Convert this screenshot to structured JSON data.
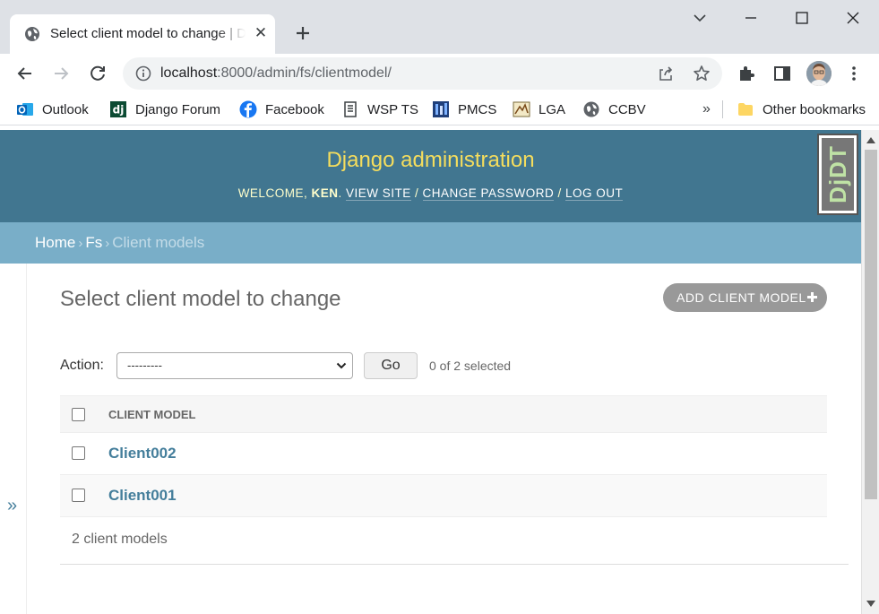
{
  "browser": {
    "tab_title": "Select client model to change | Django site admin",
    "url_host": "localhost",
    "url_rest": ":8000/admin/fs/clientmodel/",
    "bookmarks": [
      "Outlook",
      "Django Forum",
      "Facebook",
      "WSP TS",
      "PMCS",
      "LGA",
      "CCBV"
    ],
    "bookmarks_more": "»",
    "other_bookmarks": "Other bookmarks"
  },
  "header": {
    "branding": "Django administration",
    "welcome": "WELCOME, ",
    "user": "KEN",
    "view_site": "VIEW SITE",
    "change_password": "CHANGE PASSWORD",
    "log_out": "LOG OUT",
    "debug_toolbar": "DjDT"
  },
  "breadcrumbs": {
    "home": "Home",
    "app": "Fs",
    "current": "Client models",
    "separator": "›"
  },
  "nav_toggle": "»",
  "content": {
    "title": "Select client model to change",
    "add_button": "ADD CLIENT MODEL"
  },
  "actions": {
    "label": "Action:",
    "selected_option": "---------",
    "go": "Go",
    "selection_count": "0 of 2 selected"
  },
  "results": {
    "column": "CLIENT MODEL",
    "rows": [
      "Client002",
      "Client001"
    ],
    "paginator": "2 client models"
  },
  "colors": {
    "header_bg": "#417690",
    "branding": "#f5dd5d",
    "breadcrumbs_bg": "#79aec8",
    "link": "#447e9b"
  }
}
